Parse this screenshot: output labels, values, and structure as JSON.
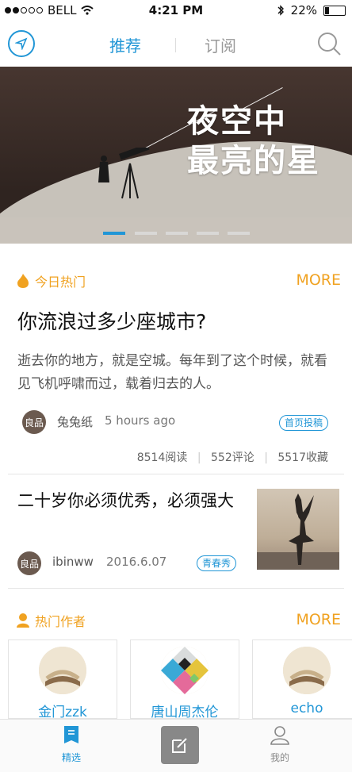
{
  "status": {
    "carrier": "BELL",
    "time": "4:21 PM",
    "battery": "22%"
  },
  "nav": {
    "tabs": [
      "推荐",
      "订阅"
    ]
  },
  "banner": {
    "line1": "夜空中",
    "line2": "最亮的星",
    "page_count": 5,
    "active_index": 0
  },
  "hot_today": {
    "label": "今日热门",
    "more": "MORE",
    "article": {
      "title": "你流浪过多少座城市?",
      "desc": "逝去你的地方，就是空城。每年到了这个时候，就看见飞机呼啸而过，载着归去的人。",
      "avatar_text": "良品",
      "author": "兔兔纸",
      "time": "5 hours ago",
      "badge": "首页投稿",
      "reads": "8514阅读",
      "comments": "552评论",
      "favs": "5517收藏"
    },
    "article2": {
      "title": "二十岁你必须优秀，必须强大",
      "avatar_text": "良品",
      "author": "ibinww",
      "time": "2016.6.07",
      "badge": "青春秀"
    }
  },
  "hot_authors": {
    "label": "热门作者",
    "more": "MORE",
    "items": [
      {
        "name": "金门zzk"
      },
      {
        "name": "唐山周杰伦"
      },
      {
        "name": "echo"
      }
    ]
  },
  "tabbar": {
    "items": [
      {
        "label": "精选"
      },
      {
        "label": "我的"
      }
    ]
  },
  "colors": {
    "accent": "#2196d6",
    "orange": "#f0a221"
  }
}
